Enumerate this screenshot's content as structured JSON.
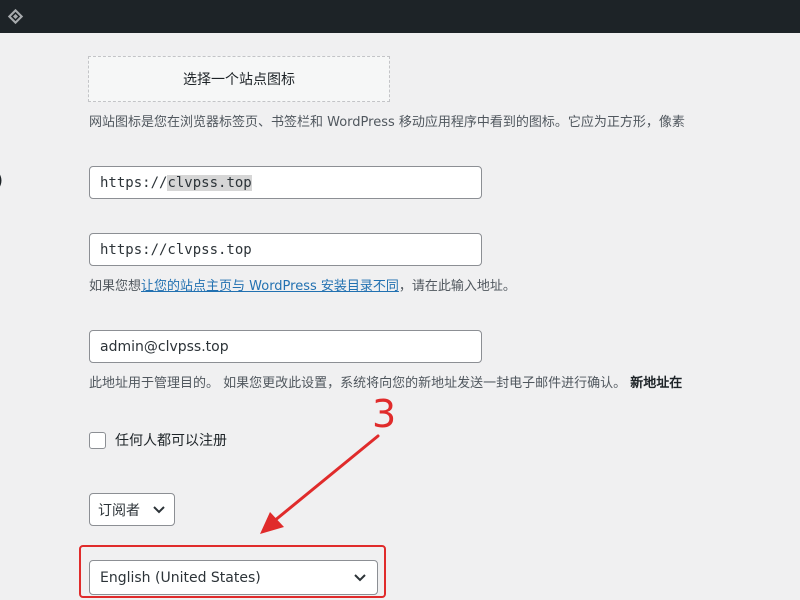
{
  "site_icon": {
    "button_label": "选择一个站点图标",
    "description": "网站图标是您在浏览器标签页、书签栏和 WordPress 移动应用程序中看到的图标。它应为正方形，像素"
  },
  "left_edge_fragment": ")",
  "wp_address": {
    "value_selected_prefix": "https://",
    "value_selected_part": "clvpss.top"
  },
  "site_address": {
    "value": "https://clvpss.top",
    "description_prefix": "如果您想",
    "description_link": "让您的站点主页与 WordPress 安装目录不同",
    "description_suffix": "，请在此输入地址。"
  },
  "admin_email": {
    "value": "admin@clvpss.top",
    "description": "此地址用于管理目的。 如果您更改此设置，系统将向您的新地址发送一封电子邮件进行确认。",
    "description_bold": "新地址在"
  },
  "membership": {
    "checkbox_label": "任何人都可以注册",
    "checked": false
  },
  "default_role": {
    "selected": "订阅者"
  },
  "site_language": {
    "selected": "English (United States)"
  },
  "annotation": {
    "number": "3",
    "color": "#e02b2b"
  },
  "colors": {
    "admin_bar": "#1d2327",
    "background": "#f0f0f1",
    "link": "#2271b1"
  }
}
